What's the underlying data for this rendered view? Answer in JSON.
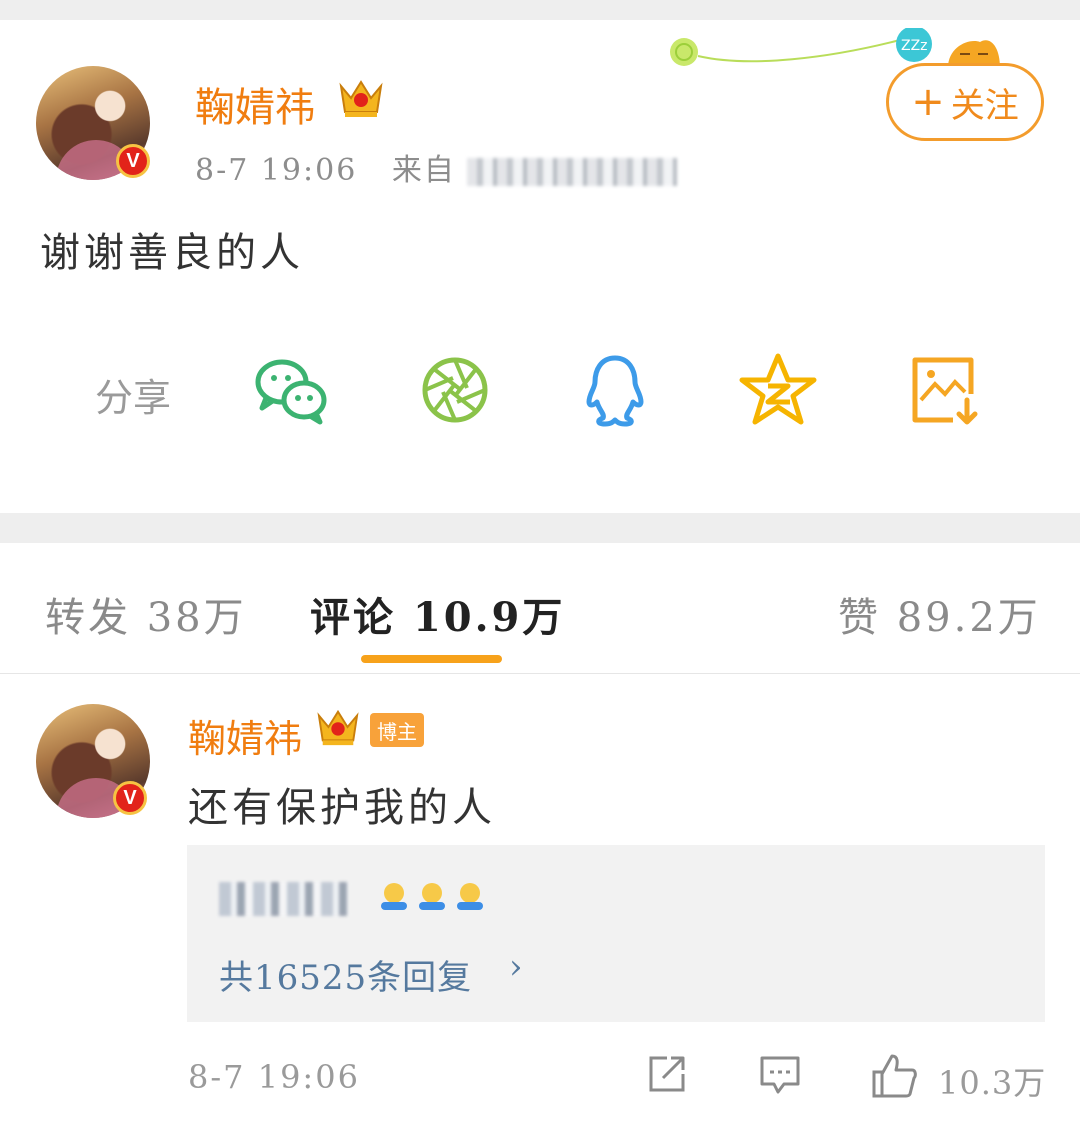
{
  "post": {
    "author": "鞠婧祎",
    "verified_badge": "V",
    "timestamp": "8-7 19:06",
    "source_prefix": "来自",
    "content": "谢谢善良的人",
    "follow_button": {
      "plus": "+",
      "label": "关注"
    }
  },
  "share": {
    "label": "分享",
    "targets": [
      {
        "icon": "wechat-icon",
        "color": "#3cb371"
      },
      {
        "icon": "moments-icon",
        "color": "#8bc34a"
      },
      {
        "icon": "qq-icon",
        "color": "#3d9be9"
      },
      {
        "icon": "qzone-icon",
        "color": "#f6b400"
      },
      {
        "icon": "save-image-icon",
        "color": "#f5a623"
      }
    ]
  },
  "tabs": [
    {
      "label": "转发",
      "count": "38万",
      "active": false
    },
    {
      "label": "评论",
      "count": "10.9万",
      "active": true
    },
    {
      "label": "赞",
      "count": "89.2万",
      "active": false
    }
  ],
  "comment": {
    "author": "鞠婧祎",
    "verified_badge": "V",
    "tag": "博主",
    "content": "还有保护我的人",
    "reply_count_text": "共16525条回复",
    "chevron": "›",
    "timestamp": "8-7 19:06",
    "like_count": "10.3万"
  },
  "colors": {
    "accent_orange": "#f07d10",
    "tab_underline": "#f7a21b",
    "link_blue": "#55799e"
  }
}
